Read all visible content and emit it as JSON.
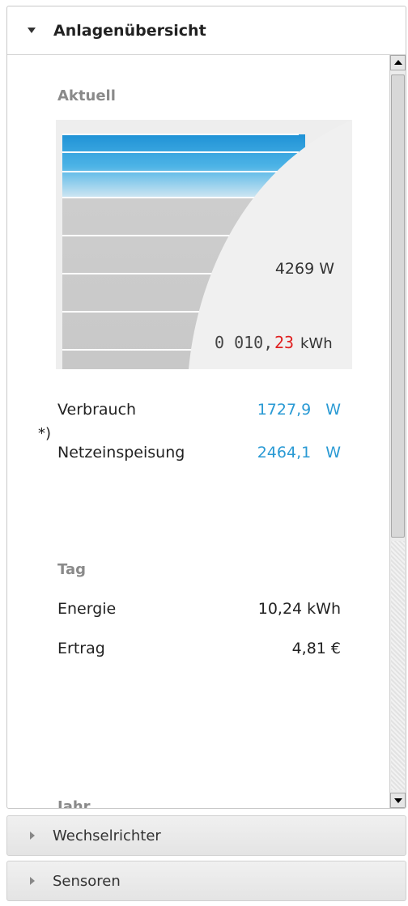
{
  "panel": {
    "title": "Anlagenübersicht"
  },
  "current": {
    "section_title": "Aktuell",
    "power_display": "4269 W",
    "counter_digits": "0 010,",
    "counter_decimals": "23",
    "counter_unit": "kWh",
    "rows": [
      {
        "label": "Verbrauch",
        "value": "1727,9",
        "unit": "W"
      },
      {
        "label": "Netzeinspeisung",
        "value": "2464,1",
        "unit": "W"
      }
    ],
    "footnote": "*)"
  },
  "day": {
    "section_title": "Tag",
    "rows": [
      {
        "label": "Energie",
        "value": "10,24 kWh"
      },
      {
        "label": "Ertrag",
        "value": "4,81 €"
      }
    ]
  },
  "year": {
    "section_title": "Jahr"
  },
  "collapsed_sections": [
    {
      "label": "Wechselrichter"
    },
    {
      "label": "Sensoren"
    }
  ],
  "colors": {
    "accent_blue": "#2a9ad4",
    "counter_red": "#e02020"
  }
}
